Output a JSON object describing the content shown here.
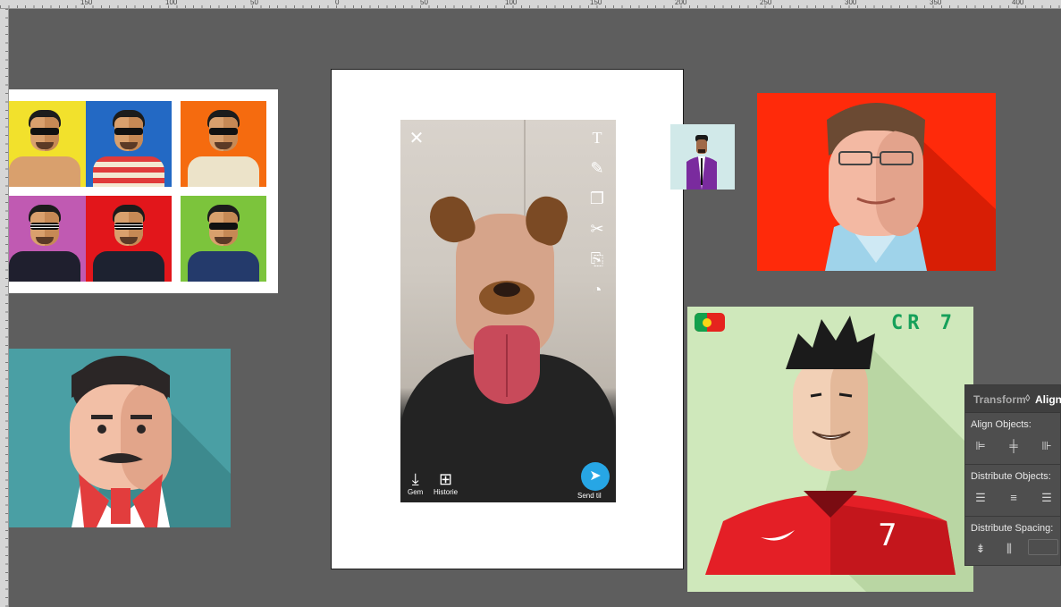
{
  "ruler": {
    "top_labels": [
      "150",
      "100",
      "50",
      "0",
      "50",
      "100",
      "150",
      "200",
      "250",
      "300",
      "350",
      "400"
    ]
  },
  "canvas": {
    "background": "#5e5e5e"
  },
  "phone": {
    "close_icon": "close-icon",
    "tools": [
      "text-icon",
      "pencil-icon",
      "sticker-icon",
      "scissors-icon",
      "paperclip-icon",
      "timer-icon"
    ],
    "save_label": "Gem",
    "story_label": "Historie",
    "send_label": "Send til"
  },
  "cr7": {
    "title": "CR 7",
    "shirt_number": "7"
  },
  "panel": {
    "tab_transform": "Transform",
    "tab_separator": "◊",
    "tab_align": "Align",
    "align_objects_label": "Align Objects:",
    "distribute_objects_label": "Distribute Objects:",
    "distribute_spacing_label": "Distribute Spacing:",
    "spacing_value": ""
  },
  "colors": {
    "accent_send": "#27a6e5",
    "gates_bg": "#ff2a0a",
    "tesla_bg": "#4a9fa4",
    "cr7_bg": "#cfe8bb"
  }
}
